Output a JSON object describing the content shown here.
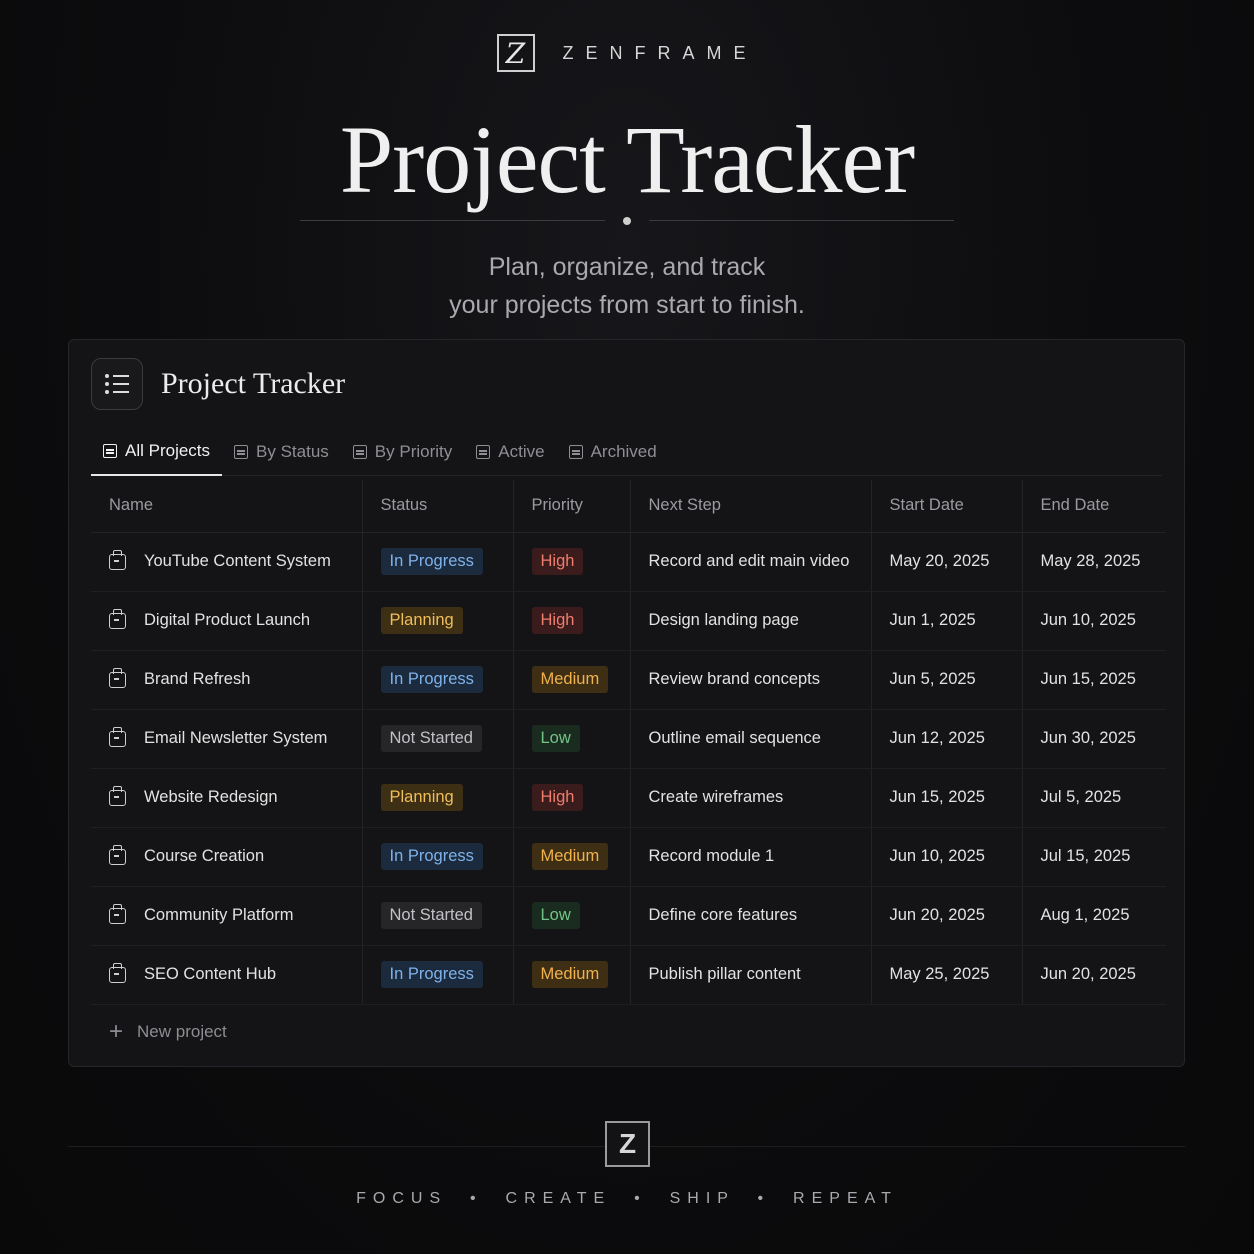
{
  "brand": {
    "logo_letter": "Z",
    "name": "ZENFRAME"
  },
  "hero": {
    "title": "Project Tracker",
    "subtitle_line1": "Plan, organize, and track",
    "subtitle_line2": "your projects from start to finish."
  },
  "panel": {
    "icon": "list-icon",
    "title": "Project Tracker",
    "tabs": [
      {
        "label": "All Projects",
        "active": true
      },
      {
        "label": "By Status",
        "active": false
      },
      {
        "label": "By Priority",
        "active": false
      },
      {
        "label": "Active",
        "active": false
      },
      {
        "label": "Archived",
        "active": false
      }
    ],
    "columns": [
      "Name",
      "Status",
      "Priority",
      "Next Step",
      "Start Date",
      "End Date"
    ],
    "rows": [
      {
        "name": "YouTube Content System",
        "status": "In Progress",
        "priority": "High",
        "next_step": "Record and edit main video",
        "start": "May 20, 2025",
        "end": "May 28, 2025"
      },
      {
        "name": "Digital Product Launch",
        "status": "Planning",
        "priority": "High",
        "next_step": "Design landing page",
        "start": "Jun 1, 2025",
        "end": "Jun 10, 2025"
      },
      {
        "name": "Brand Refresh",
        "status": "In Progress",
        "priority": "Medium",
        "next_step": "Review brand concepts",
        "start": "Jun 5, 2025",
        "end": "Jun 15, 2025"
      },
      {
        "name": "Email Newsletter System",
        "status": "Not Started",
        "priority": "Low",
        "next_step": "Outline email sequence",
        "start": "Jun 12, 2025",
        "end": "Jun 30, 2025"
      },
      {
        "name": "Website Redesign",
        "status": "Planning",
        "priority": "High",
        "next_step": "Create wireframes",
        "start": "Jun 15, 2025",
        "end": "Jul 5, 2025"
      },
      {
        "name": "Course Creation",
        "status": "In Progress",
        "priority": "Medium",
        "next_step": "Record module 1",
        "start": "Jun 10, 2025",
        "end": "Jul 15, 2025"
      },
      {
        "name": "Community Platform",
        "status": "Not Started",
        "priority": "Low",
        "next_step": "Define core features",
        "start": "Jun 20, 2025",
        "end": "Aug 1, 2025"
      },
      {
        "name": "SEO Content Hub",
        "status": "In Progress",
        "priority": "Medium",
        "next_step": "Publish pillar content",
        "start": "May 25, 2025",
        "end": "Jun 20, 2025"
      }
    ],
    "new_project_label": "New project"
  },
  "footer": {
    "logo_letter": "Z",
    "tagline": "FOCUS  •  CREATE  •  SHIP  •  REPEAT"
  },
  "colors": {
    "background": "#0b0b0d",
    "panel": "#141416",
    "status_in_progress": "#7fb2ea",
    "status_planning": "#f0be5a",
    "status_not_started": "#c2c2c6",
    "priority_high": "#ef7d6e",
    "priority_medium": "#f1b24d",
    "priority_low": "#74c486"
  }
}
